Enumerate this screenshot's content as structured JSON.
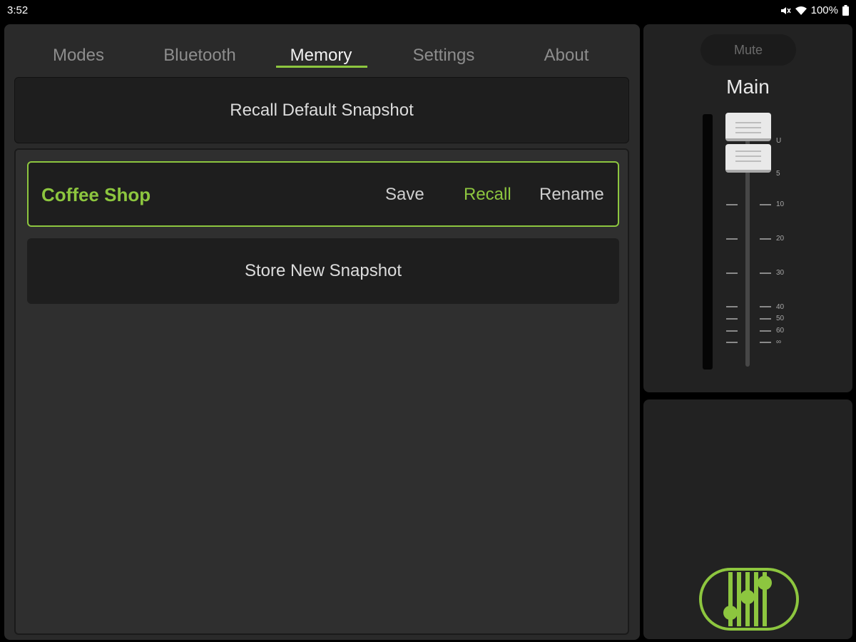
{
  "status": {
    "time": "3:52",
    "battery": "100%"
  },
  "tabs": [
    {
      "label": "Modes",
      "active": false
    },
    {
      "label": "Bluetooth",
      "active": false
    },
    {
      "label": "Memory",
      "active": true
    },
    {
      "label": "Settings",
      "active": false
    },
    {
      "label": "About",
      "active": false
    }
  ],
  "memory": {
    "recall_default": "Recall Default Snapshot",
    "snapshot": {
      "name": "Coffee Shop",
      "save": "Save",
      "recall": "Recall",
      "rename": "Rename"
    },
    "store_new": "Store New Snapshot"
  },
  "fader": {
    "mute": "Mute",
    "channel": "Main",
    "scale": [
      "U",
      "5",
      "10",
      "20",
      "30",
      "40",
      "50",
      "60",
      "∞"
    ]
  },
  "colors": {
    "accent": "#8dc63f",
    "panel": "#2a2a2a",
    "background": "#000000"
  },
  "icons": [
    "wifi-icon",
    "battery-icon",
    "mute-status-icon",
    "app-logo-icon"
  ]
}
